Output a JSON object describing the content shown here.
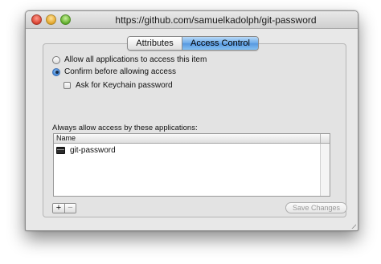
{
  "window": {
    "title": "https://github.com/samuelkadolph/git-password"
  },
  "tabs": [
    {
      "label": "Attributes",
      "active": false
    },
    {
      "label": "Access Control",
      "active": true
    }
  ],
  "access": {
    "option_allow_all": "Allow all applications to access this item",
    "option_confirm": "Confirm before allowing access",
    "selected_option": "Confirm before allowing access",
    "ask_keychain_password": "Ask for Keychain password",
    "ask_keychain_password_checked": false
  },
  "apps": {
    "section_label": "Always allow access by these applications:",
    "column_header": "Name",
    "rows": [
      {
        "name": "git-password",
        "icon": "terminal-app-icon"
      }
    ]
  },
  "buttons": {
    "add": "+",
    "remove": "−",
    "save": "Save Changes"
  },
  "colors": {
    "active_tab": "#5f9ee5",
    "radio_selected": "#3e86d8"
  }
}
